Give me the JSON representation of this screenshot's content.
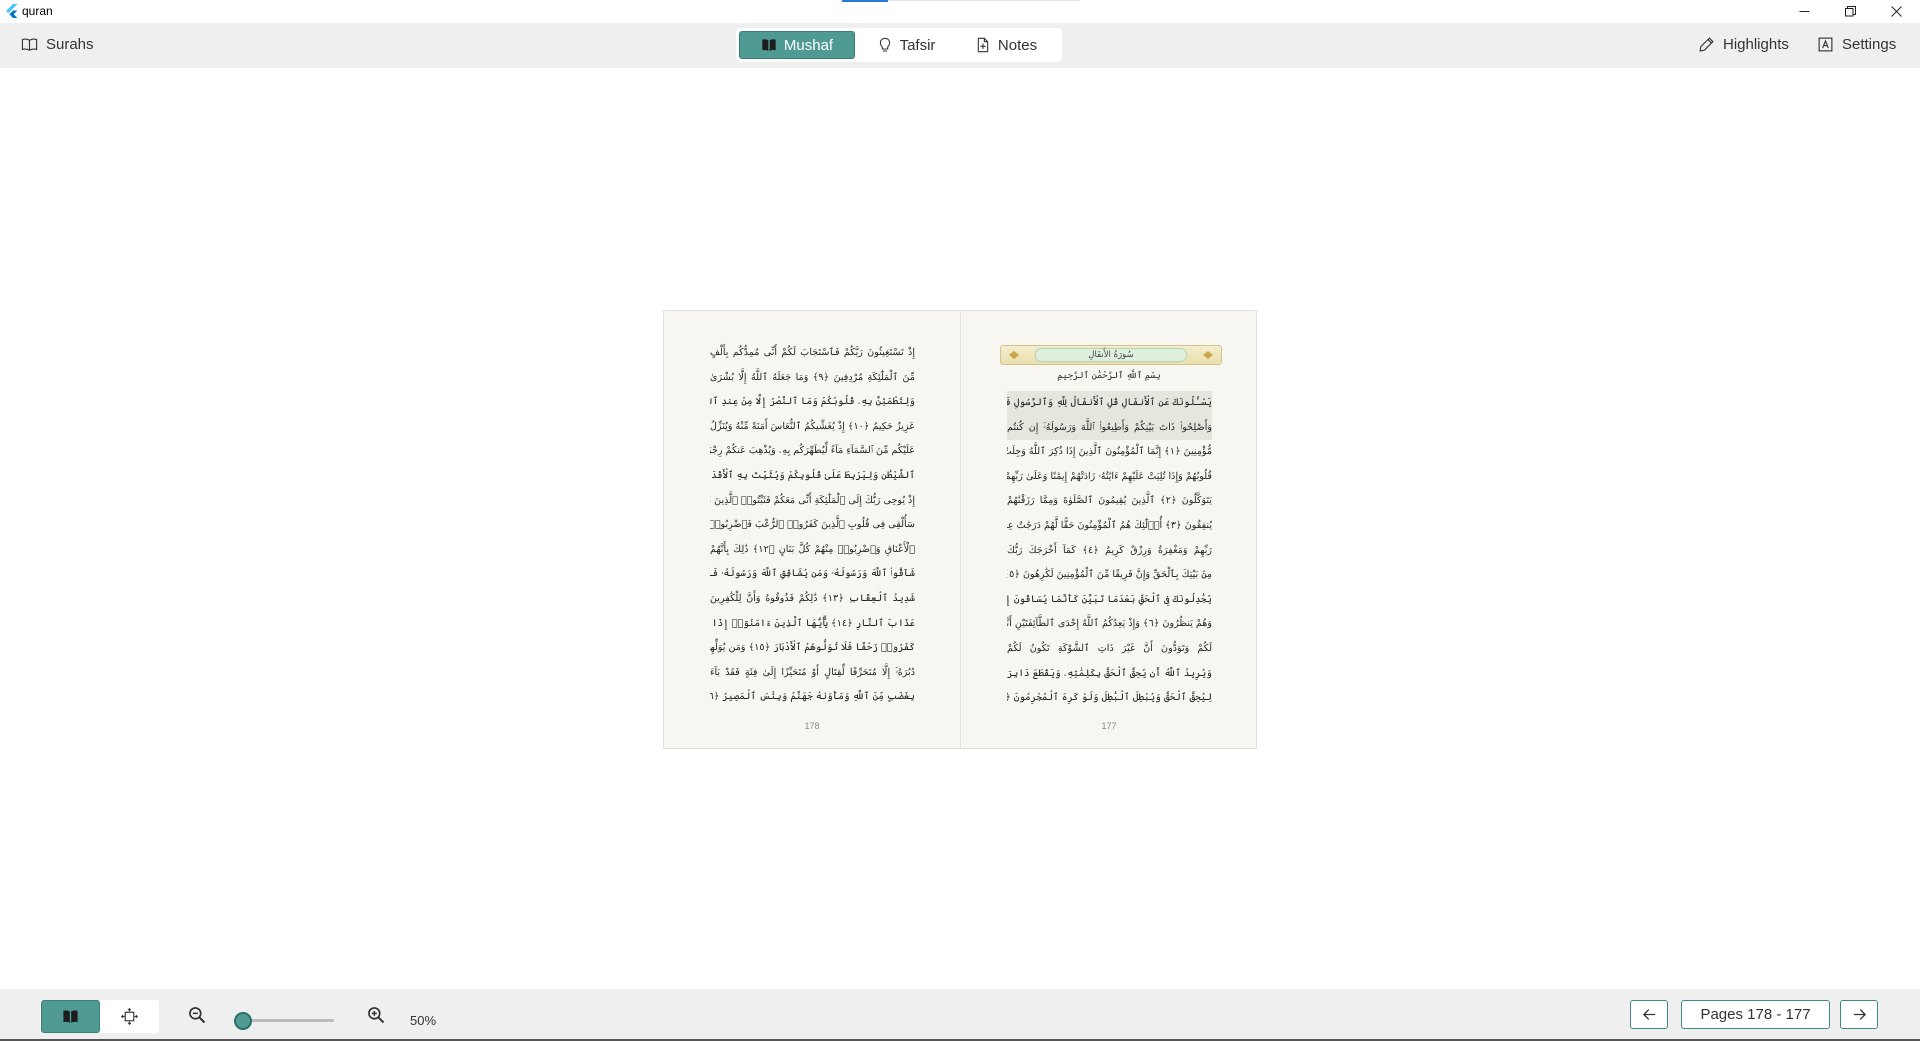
{
  "window": {
    "title": "quran"
  },
  "toolbar": {
    "surahs_label": "Surahs",
    "tabs": [
      {
        "label": "Mushaf",
        "icon": "book-open-icon",
        "active": true
      },
      {
        "label": "Tafsir",
        "icon": "lightbulb-icon",
        "active": false
      },
      {
        "label": "Notes",
        "icon": "note-add-icon",
        "active": false
      }
    ],
    "highlights_label": "Highlights",
    "settings_label": "Settings"
  },
  "mushaf": {
    "left_page": {
      "number": "178",
      "lines": [
        "إِذْ تَسْتَغِيثُونَ رَبَّكُمْ فَٱسْتَجَابَ لَكُمْ أَنِّى مُمِدُّكُم بِأَلْفٍ",
        "مِّنَ ٱلْمَلَٰٓئِكَةِ مُرْدِفِينَ ﴿٩﴾ وَمَا جَعَلَهُ ٱللَّهُ إِلَّا بُشْرَىٰ",
        "وَلِتَطْمَئِنَّ بِهِۦ قُلُوبُكُمْ وَمَا ٱلنَّصْرُ إِلَّا مِنْ عِندِ ٱللَّهِ إِنَّ ٱللَّهَ",
        "عَزِيزٌ حَكِيمٌ ﴿١٠﴾ إِذْ يُغَشِّيكُمُ ٱلنُّعَاسَ أَمَنَةً مِّنْهُ وَيُنَزِّلُ",
        "عَلَيْكُم مِّنَ ٱلسَّمَآءِ مَآءً لِّيُطَهِّرَكُم بِهِۦ وَيُذْهِبَ عَنكُمْ رِجْزَ",
        "ٱلشَّيْطَٰنِ وَلِيَرْبِطَ عَلَىٰ قُلُوبِكُمْ وَيُثَبِّتَ بِهِ ٱلْأَقْدَامَ ﴿١١﴾",
        "إِذْ يُوحِى رَبُّكَ إِلَى ٱلْمَلَٰٓئِكَةِ أَنِّى مَعَكُمْ فَثَبِّتُوا۟ ٱلَّذِينَ ءَامَنُوا۟",
        "سَأُلْقِى فِى قُلُوبِ ٱلَّذِينَ كَفَرُوا۟ ٱلرُّعْبَ فَٱضْرِبُوا۟ فَوْقَ",
        "ٱلْأَعْنَاقِ وَٱضْرِبُوا۟ مِنْهُمْ كُلَّ بَنَانٍ ﴿١٢﴾ ذَٰلِكَ بِأَنَّهُمْ",
        "شَآقُّوا۟ ٱللَّهَ وَرَسُولَهُۥ وَمَن يُشَاقِقِ ٱللَّهَ وَرَسُولَهُۥ فَإِنَّ ٱللَّهَ",
        "شَدِيدُ ٱلْعِقَابِ ﴿١٣﴾ ذَٰلِكُمْ فَذُوقُوهُ وَأَنَّ لِلْكَٰفِرِينَ",
        "عَذَابَ ٱلنَّارِ ﴿١٤﴾ يَٰٓأَيُّهَا ٱلَّذِينَ ءَامَنُوٓا۟ إِذَا لَقِيتُمُ ٱلَّذِينَ",
        "كَفَرُوا۟ زَحْفًا فَلَا تُوَلُّوهُمُ ٱلْأَدْبَارَ ﴿١٥﴾ وَمَن يُوَلِّهِمْ يَوْمَئِذٍ",
        "دُبُرَهُۥٓ إِلَّا مُتَحَرِّفًا لِّقِتَالٍ أَوْ مُتَحَيِّزًا إِلَىٰ فِئَةٍ فَقَدْ بَآءَ",
        "بِغَضَبٍ مِّنَ ٱللَّهِ وَمَأْوَىٰهُ جَهَنَّمُ وَبِئْسَ ٱلْمَصِيرُ ﴿١٦﴾"
      ]
    },
    "right_page": {
      "number": "177",
      "surah_title": "سُورَةُ الأَنفَالِ",
      "basmala": "بِسْمِ ٱللَّهِ ٱلرَّحْمَٰنِ ٱلرَّحِيمِ",
      "lines": [
        "يَسْـَٔلُونَكَ عَنِ ٱلْأَنفَالِ قُلِ ٱلْأَنفَالُ لِلَّهِ وَٱلرَّسُولِ فَٱتَّقُوا۟ ٱللَّهَ",
        "وَأَصْلِحُوا۟ ذَاتَ بَيْنِكُمْ وَأَطِيعُوا۟ ٱللَّهَ وَرَسُولَهُۥٓ إِن كُنتُم",
        "مُّؤْمِنِينَ ﴿١﴾ إِنَّمَا ٱلْمُؤْمِنُونَ ٱلَّذِينَ إِذَا ذُكِرَ ٱللَّهُ وَجِلَتْ",
        "قُلُوبُهُمْ وَإِذَا تُلِيَتْ عَلَيْهِمْ ءَايَٰتُهُۥ زَادَتْهُمْ إِيمَٰنًا وَعَلَىٰ رَبِّهِمْ",
        "يَتَوَكَّلُونَ ﴿٢﴾ ٱلَّذِينَ يُقِيمُونَ ٱلصَّلَوٰةَ وَمِمَّا رَزَقْنَٰهُمْ",
        "يُنفِقُونَ ﴿٣﴾ أُو۟لَٰٓئِكَ هُمُ ٱلْمُؤْمِنُونَ حَقًّا لَّهُمْ دَرَجَٰتٌ عِندَ",
        "رَبِّهِمْ وَمَغْفِرَةٌ وَرِزْقٌ كَرِيمٌ ﴿٤﴾ كَمَآ أَخْرَجَكَ رَبُّكَ",
        "مِنۢ بَيْتِكَ بِٱلْحَقِّ وَإِنَّ فَرِيقًا مِّنَ ٱلْمُؤْمِنِينَ لَكَٰرِهُونَ ﴿٥﴾",
        "يُجَٰدِلُونَكَ فِى ٱلْحَقِّ بَعْدَمَا تَبَيَّنَ كَأَنَّمَا يُسَاقُونَ إِلَى ٱلْمَوْتِ",
        "وَهُمْ يَنظُرُونَ ﴿٦﴾ وَإِذْ يَعِدُكُمُ ٱللَّهُ إِحْدَى ٱلطَّآئِفَتَيْنِ أَنَّهَا",
        "لَكُمْ وَتَوَدُّونَ أَنَّ غَيْرَ ذَاتِ ٱلشَّوْكَةِ تَكُونُ لَكُمْ",
        "وَيُرِيدُ ٱللَّهُ أَن يُحِقَّ ٱلْحَقَّ بِكَلِمَٰتِهِۦ وَيَقْطَعَ دَابِرَ ٱلْكَٰفِرِينَ",
        "لِيُحِقَّ ٱلْحَقَّ وَيُبْطِلَ ٱلْبَٰطِلَ وَلَوْ كَرِهَ ٱلْمُجْرِمُونَ ﴿٨﴾"
      ]
    }
  },
  "bottom": {
    "zoom_label": "50%",
    "zoom_level": 0.0,
    "pages_label": "Pages 178 - 177"
  },
  "colors": {
    "accent": "#4f9a93",
    "page_bg": "#f7f6f0",
    "bar_bg": "#efefef"
  }
}
